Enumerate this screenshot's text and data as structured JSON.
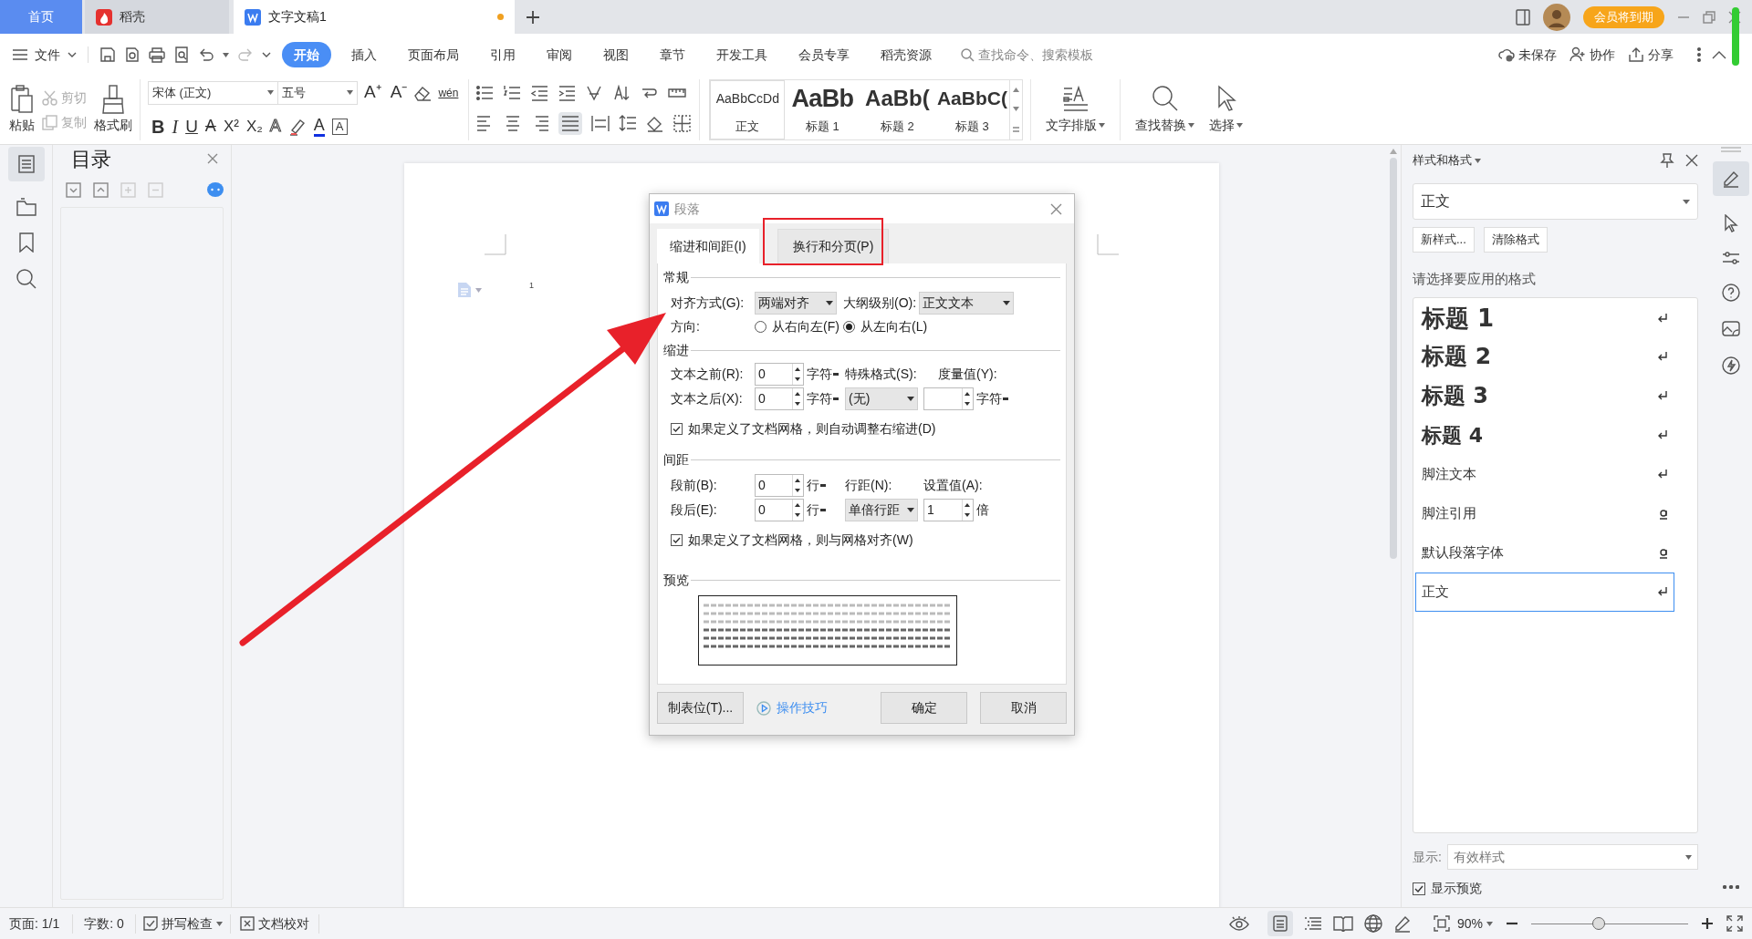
{
  "tabs": [
    {
      "kind": "home",
      "label": "首页",
      "selected": false
    },
    {
      "kind": "docer",
      "label": "稻壳",
      "selected": false
    },
    {
      "kind": "writer",
      "label": "文字文稿1",
      "selected": true,
      "unsaved": true
    }
  ],
  "member_badge": "会员将到期",
  "menu": {
    "file": "文件",
    "tabs": [
      {
        "label": "开始",
        "selected": true
      },
      {
        "label": "插入",
        "selected": false
      },
      {
        "label": "页面布局",
        "selected": false
      },
      {
        "label": "引用",
        "selected": false
      },
      {
        "label": "审阅",
        "selected": false
      },
      {
        "label": "视图",
        "selected": false
      },
      {
        "label": "章节",
        "selected": false
      },
      {
        "label": "开发工具",
        "selected": false
      },
      {
        "label": "会员专享",
        "selected": false
      },
      {
        "label": "稻壳资源",
        "selected": false
      }
    ],
    "search_placeholder": "查找命令、搜索模板",
    "actions": [
      {
        "kind": "cloud",
        "label": "未保存"
      },
      {
        "kind": "people",
        "label": "协作"
      },
      {
        "kind": "share",
        "label": "分享"
      }
    ]
  },
  "ribbon": {
    "paste": "粘贴",
    "cut": {
      "label": "剪切",
      "disabled": true
    },
    "copy": {
      "label": "复制",
      "disabled": true
    },
    "format_painter": "格式刷",
    "font": "宋体 (正文)",
    "size": "五号",
    "font_tools": [
      {
        "kind": "grow",
        "text": "A⁺"
      },
      {
        "kind": "shrink",
        "text": "A⁻"
      },
      {
        "kind": "eraser"
      },
      {
        "kind": "phonetic",
        "text": "wén"
      }
    ],
    "format": [
      {
        "kind": "bold",
        "text": "B"
      },
      {
        "kind": "italic",
        "text": "I"
      },
      {
        "kind": "underline",
        "text": "U"
      },
      {
        "kind": "strike",
        "text": "A"
      },
      {
        "kind": "sup",
        "text": "X²"
      },
      {
        "kind": "sub",
        "text": "X₂"
      },
      {
        "kind": "effect",
        "text": "A"
      },
      {
        "kind": "highlight"
      },
      {
        "kind": "color",
        "text": "A"
      },
      {
        "kind": "boxed",
        "text": "A"
      }
    ],
    "styles": [
      {
        "preview": "AaBbCcDd",
        "label": "正文",
        "kind": "body",
        "selected": true
      },
      {
        "preview": "AaBb",
        "label": "标题 1",
        "kind": "h1",
        "selected": false
      },
      {
        "preview": "AaBb(",
        "label": "标题 2",
        "kind": "h2",
        "selected": false
      },
      {
        "preview": "AaBbC(",
        "label": "标题 3",
        "kind": "h3",
        "selected": false
      }
    ],
    "layout": "文字排版",
    "find": "查找替换",
    "select": "选择"
  },
  "toc": {
    "title": "目录"
  },
  "document": {
    "page_number": "1"
  },
  "dialog": {
    "title": "段落",
    "tabs": [
      {
        "label": "缩进和间距(I)",
        "selected": true
      },
      {
        "label": "换行和分页(P)",
        "selected": false
      }
    ],
    "general": {
      "heading": "常规",
      "align_label": "对齐方式(G):",
      "align": "两端对齐",
      "outline_label": "大纲级别(O):",
      "outline": "正文文本",
      "direction_label": "方向:",
      "directions": [
        {
          "label": "从右向左(F)",
          "selected": false
        },
        {
          "label": "从左向右(L)",
          "selected": true
        }
      ]
    },
    "indent": {
      "heading": "缩进",
      "before_label": "文本之前(R):",
      "before": "0",
      "before_unit": "字符",
      "special_label": "特殊格式(S):",
      "measure_label": "度量值(Y):",
      "after_label": "文本之后(X):",
      "after": "0",
      "after_unit": "字符",
      "special": "(无)",
      "measure_unit": "字符",
      "grid_option": {
        "label": "如果定义了文档网格，则自动调整右缩进(D)",
        "checked": true
      }
    },
    "spacing": {
      "heading": "间距",
      "before_label": "段前(B):",
      "before": "0",
      "before_unit": "行",
      "line_label": "行距(N):",
      "value_label": "设置值(A):",
      "after_label": "段后(E):",
      "after": "0",
      "after_unit": "行",
      "line": "单倍行距",
      "value": "1",
      "value_unit": "倍",
      "grid_option": {
        "label": "如果定义了文档网格，则与网格对齐(W)",
        "checked": true
      }
    },
    "preview_heading": "预览",
    "buttons": {
      "tabs": "制表位(T)...",
      "tips": "操作技巧",
      "ok": "确定",
      "cancel": "取消"
    }
  },
  "styles_panel": {
    "title": "样式和格式",
    "current": "正文",
    "new_style": "新样式...",
    "clear": "清除格式",
    "prompt": "请选择要应用的格式",
    "styles": [
      {
        "label": "标题 1",
        "kind": "h1",
        "selected": false
      },
      {
        "label": "标题 2",
        "kind": "h2",
        "selected": false
      },
      {
        "label": "标题 3",
        "kind": "h3",
        "selected": false
      },
      {
        "label": "标题 4",
        "kind": "h4",
        "selected": false
      },
      {
        "label": "脚注文本",
        "kind": "paragraph",
        "selected": false
      },
      {
        "label": "脚注引用",
        "kind": "character",
        "selected": false
      },
      {
        "label": "默认段落字体",
        "kind": "character",
        "selected": false
      },
      {
        "label": "正文",
        "kind": "paragraph",
        "selected": true
      }
    ],
    "show_label": "显示:",
    "show": "有效样式",
    "preview_option": {
      "label": "显示预览",
      "checked": true
    }
  },
  "status_bar": {
    "page": "页面: 1/1",
    "words": "字数: 0",
    "spell": "拼写检查",
    "proof": "文档校对",
    "zoom": "90%",
    "zoom_slider": {
      "level": 0.43
    }
  }
}
